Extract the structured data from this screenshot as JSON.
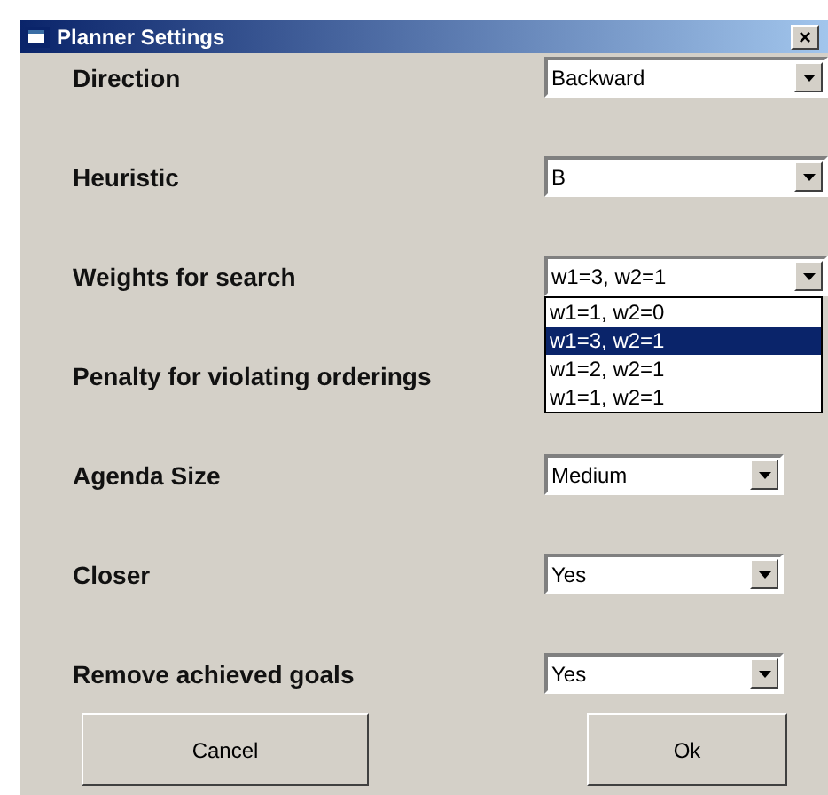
{
  "window": {
    "title": "Planner Settings",
    "close": "×"
  },
  "settings": [
    {
      "label": "Direction",
      "value": "Backward"
    },
    {
      "label": "Heuristic",
      "value": "B"
    },
    {
      "label": "Weights for search",
      "value": "w1=3, w2=1",
      "expanded": true,
      "options": [
        {
          "label": "w1=1, w2=0",
          "selected": false
        },
        {
          "label": "w1=3, w2=1",
          "selected": true
        },
        {
          "label": "w1=2, w2=1",
          "selected": false
        },
        {
          "label": "w1=1, w2=1",
          "selected": false
        }
      ]
    },
    {
      "label": "Penalty for violating orderings"
    },
    {
      "label": "Agenda Size",
      "value": "Medium"
    },
    {
      "label": "Closer",
      "value": "Yes"
    },
    {
      "label": "Remove achieved goals",
      "value": "Yes"
    }
  ],
  "buttons": [
    "Cancel",
    "Ok"
  ]
}
